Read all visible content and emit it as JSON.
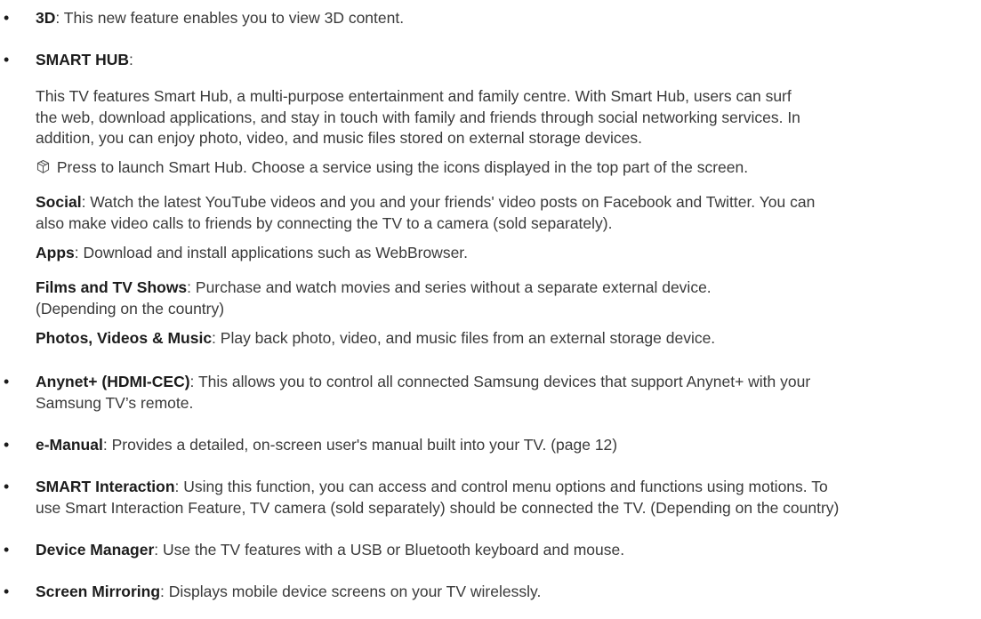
{
  "items": {
    "i3d": {
      "bullet": "•",
      "term": "3D",
      "text": ": This new feature enables you to view 3D content."
    },
    "smarthub": {
      "bullet": "•",
      "term": "SMART HUB",
      "text": ":",
      "intro_lines": [
        "This TV features Smart Hub, a multi-purpose entertainment and family centre. With Smart Hub, users can surf",
        "the web, download applications, and stay in touch with family and friends through social networking services. In",
        "addition, you can enjoy photo, video, and music files stored on external storage devices."
      ],
      "press_text": " Press to launch Smart Hub. Choose a service using the icons displayed in the top part of the screen.",
      "hub_icon": "smart-hub-icon",
      "social": {
        "term": "Social",
        "line1": ": Watch the latest YouTube videos and you and your friends' video posts on Facebook and Twitter. You can",
        "line2": "also make video calls to friends by connecting the TV to a camera (sold separately)."
      },
      "apps": {
        "term": "Apps",
        "text": ": Download and install applications such as WebBrowser."
      },
      "films": {
        "term": "Films and TV Shows",
        "line1": ": Purchase and watch movies and series without a separate external device.",
        "line2": "(Depending on the country)"
      },
      "photos": {
        "term": "Photos, Videos & Music",
        "text": ": Play back photo, video, and music files from an external storage device."
      }
    },
    "anynet": {
      "bullet": "•",
      "term": "Anynet+ (HDMI-CEC)",
      "line1": ": This allows you to control all connected Samsung devices that support Anynet+ with your",
      "line2": "Samsung TV’s remote."
    },
    "emanual": {
      "bullet": "•",
      "term": "e-Manual",
      "text": ": Provides a detailed, on-screen user's manual built into your TV. (page 12)"
    },
    "interaction": {
      "bullet": "•",
      "term": "SMART Interaction",
      "line1": ": Using this function, you can access and control menu options and functions using motions. To",
      "line2": "use Smart Interaction Feature, TV camera (sold separately) should be connected the TV. (Depending on the country)"
    },
    "device": {
      "bullet": "•",
      "term": "Device Manager",
      "text": ": Use the TV features with a USB or Bluetooth keyboard and mouse."
    },
    "mirroring": {
      "bullet": "•",
      "term": "Screen Mirroring",
      "text": ": Displays mobile device screens on your TV wirelessly."
    }
  }
}
